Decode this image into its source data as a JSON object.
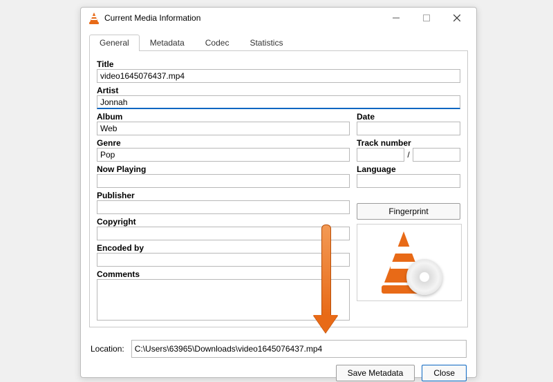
{
  "window": {
    "title": "Current Media Information"
  },
  "tabs": {
    "general": "General",
    "metadata": "Metadata",
    "codec": "Codec",
    "statistics": "Statistics"
  },
  "labels": {
    "title": "Title",
    "artist": "Artist",
    "album": "Album",
    "date": "Date",
    "genre": "Genre",
    "track_number": "Track number",
    "track_sep": "/",
    "now_playing": "Now Playing",
    "language": "Language",
    "publisher": "Publisher",
    "copyright": "Copyright",
    "encoded_by": "Encoded by",
    "comments": "Comments",
    "location": "Location:"
  },
  "values": {
    "title": "video1645076437.mp4",
    "artist": "Jonnah",
    "album": "Web",
    "date": "",
    "genre": "Pop",
    "track_a": "",
    "track_b": "",
    "now_playing": "",
    "language": "",
    "publisher": "",
    "copyright": "",
    "encoded_by": "",
    "comments": "",
    "location": "C:\\Users\\63965\\Downloads\\video1645076437.mp4"
  },
  "buttons": {
    "fingerprint": "Fingerprint",
    "save_metadata": "Save Metadata",
    "close": "Close"
  }
}
